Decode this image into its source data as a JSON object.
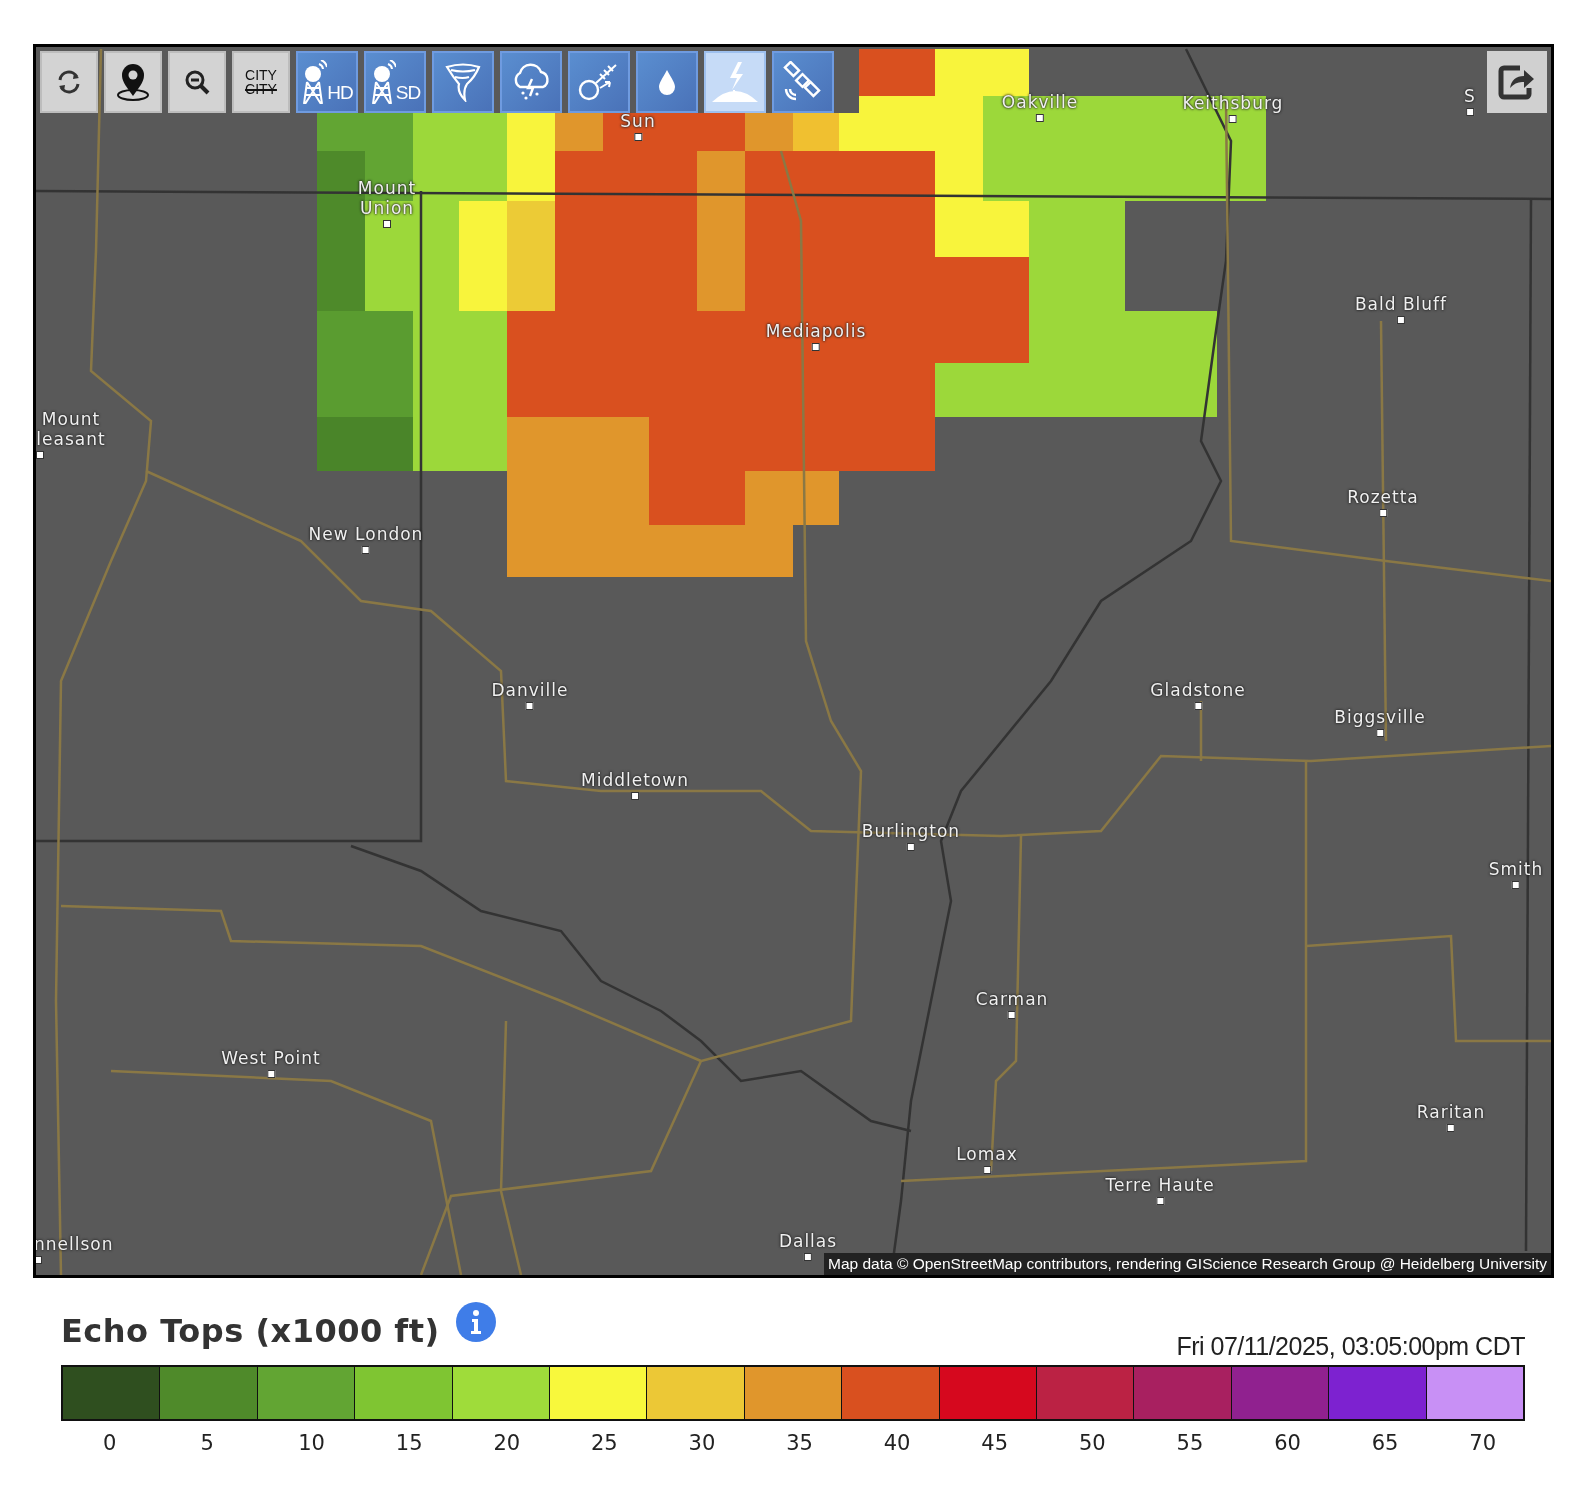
{
  "toolbar": {
    "tools": [
      {
        "kind": "refresh",
        "selected": false
      },
      {
        "kind": "location",
        "selected": false
      },
      {
        "kind": "zoom-out",
        "selected": false
      },
      {
        "kind": "city-labels",
        "label": "CITY",
        "struck_label": "CITY",
        "selected": false
      },
      {
        "kind": "radar-hd",
        "label": "HD",
        "selected": false
      },
      {
        "kind": "radar-sd",
        "label": "SD",
        "selected": false
      },
      {
        "kind": "tornado",
        "selected": false
      },
      {
        "kind": "storm",
        "selected": false
      },
      {
        "kind": "satellite-orbit",
        "selected": false
      },
      {
        "kind": "precipitation",
        "selected": false
      },
      {
        "kind": "lightning",
        "selected": true
      },
      {
        "kind": "satellite",
        "selected": false
      }
    ]
  },
  "map": {
    "cities": [
      {
        "name": "Sun"
      },
      {
        "name": "Oakville"
      },
      {
        "name": "Keithsburg"
      },
      {
        "name": "S"
      },
      {
        "name": "Mount Union"
      },
      {
        "name": "Mediapolis"
      },
      {
        "name": "Bald Bluff"
      },
      {
        "name": "Mount leasant"
      },
      {
        "name": "Rozetta"
      },
      {
        "name": "New London"
      },
      {
        "name": "Danville"
      },
      {
        "name": "Gladstone"
      },
      {
        "name": "Biggsville"
      },
      {
        "name": "Middletown"
      },
      {
        "name": "Burlington"
      },
      {
        "name": "Smith"
      },
      {
        "name": "Carman"
      },
      {
        "name": "West Point"
      },
      {
        "name": "Raritan"
      },
      {
        "name": "Lomax"
      },
      {
        "name": "Terre Haute"
      },
      {
        "name": "nnellson"
      },
      {
        "name": "Dallas"
      }
    ],
    "attribution": "Map data © OpenStreetMap contributors, rendering GIScience Research Group @ Heidelberg University"
  },
  "legend": {
    "title": "Echo Tops (x1000 ft)",
    "timestamp": "Fri 07/11/2025, 03:05:00pm CDT",
    "scale": [
      {
        "label": "0",
        "color": "#2f4f1f"
      },
      {
        "label": "5",
        "color": "#4f8a2a"
      },
      {
        "label": "10",
        "color": "#62a533"
      },
      {
        "label": "15",
        "color": "#7fc532"
      },
      {
        "label": "20",
        "color": "#9fdc3a"
      },
      {
        "label": "25",
        "color": "#f8f83c"
      },
      {
        "label": "30",
        "color": "#ecc836"
      },
      {
        "label": "35",
        "color": "#e0962c"
      },
      {
        "label": "40",
        "color": "#d9501f"
      },
      {
        "label": "45",
        "color": "#d6081e"
      },
      {
        "label": "50",
        "color": "#bb2244"
      },
      {
        "label": "55",
        "color": "#a82060"
      },
      {
        "label": "60",
        "color": "#90218f"
      },
      {
        "label": "65",
        "color": "#7d22d0"
      },
      {
        "label": "70",
        "color": "#c890f5"
      }
    ]
  }
}
